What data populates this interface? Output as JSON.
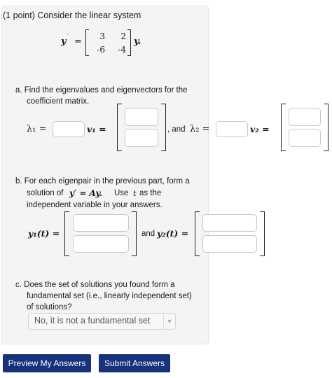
{
  "problem": {
    "intro": "(1 point) Consider the linear system",
    "system": {
      "lhs": "y",
      "equals": "=",
      "rhs_var": "y.",
      "matrix": [
        [
          "3",
          "2"
        ],
        [
          "-6",
          "-4"
        ]
      ]
    },
    "part_a": {
      "line1": "a. Find the eigenvalues and eigenvectors for the",
      "line2": "coefficient matrix.",
      "lambda1": "λ₁ =",
      "v1": "v₁ =",
      "and_text": ", and",
      "lambda2": "λ₂ =",
      "v2": "v₂ =",
      "comma": ","
    },
    "part_b": {
      "line1": "b. For each eigenpair in the previous part, form a",
      "line2_pre": "solution of",
      "line2_eq": "y′ = Ay.",
      "line2_post": "Use",
      "line2_t": "t",
      "line2_end": "as the",
      "line3": "independent variable in your answers.",
      "y1": "y₁(t) =",
      "and_text": "and",
      "y2": "y₂(t) ="
    },
    "part_c": {
      "line1": "c. Does the set of solutions you found form a",
      "line2": "fundamental set (i.e., linearly independent set)",
      "line3": "of solutions?",
      "select_value": "No, it is not a fundamental set"
    }
  },
  "buttons": {
    "preview": "Preview My Answers",
    "submit": "Submit Answers"
  }
}
